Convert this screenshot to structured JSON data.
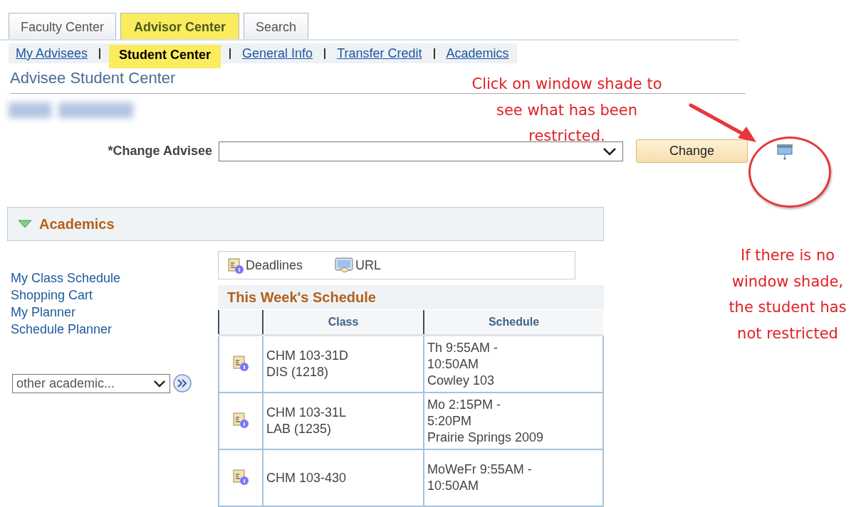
{
  "tabs": [
    {
      "label": "Faculty Center",
      "selected": false
    },
    {
      "label": "Advisor Center",
      "selected": true
    },
    {
      "label": "Search",
      "selected": false
    }
  ],
  "subnav": [
    {
      "label": "My Advisees",
      "selected": false
    },
    {
      "label": "Student Center",
      "selected": true
    },
    {
      "label": "General Info",
      "selected": false
    },
    {
      "label": "Transfer Credit",
      "selected": false
    },
    {
      "label": "Academics",
      "selected": false
    }
  ],
  "page_title": "Advisee Student Center",
  "change_advisee": {
    "label": "*Change Advisee",
    "button": "Change"
  },
  "academics": {
    "title": "Academics",
    "expanded": true,
    "links": [
      "My Class Schedule",
      "Shopping Cart",
      "My Planner",
      "Schedule Planner"
    ],
    "other_select": "other academic...",
    "toolbar": [
      {
        "kind": "deadlines",
        "label": "Deadlines"
      },
      {
        "kind": "url",
        "label": "URL"
      }
    ],
    "schedule": {
      "title": "This Week's Schedule",
      "columns": [
        "Class",
        "Schedule"
      ],
      "rows": [
        {
          "class": [
            "CHM 103-31D",
            "DIS (1218)"
          ],
          "schedule": [
            "Th 9:55AM -",
            "10:50AM",
            "Cowley 103"
          ]
        },
        {
          "class": [
            "CHM 103-31L",
            "LAB (1235)"
          ],
          "schedule": [
            "Mo 2:15PM -",
            "5:20PM",
            "Prairie Springs 2009"
          ]
        },
        {
          "class": [
            "CHM 103-430"
          ],
          "schedule": [
            "MoWeFr 9:55AM -",
            "10:50AM"
          ]
        }
      ]
    }
  },
  "annotations": [
    {
      "kind": "top",
      "text": "Click on window shade to see what has been restricted."
    },
    {
      "kind": "side",
      "text": "If there is no window shade, the student has not restricted"
    }
  ]
}
